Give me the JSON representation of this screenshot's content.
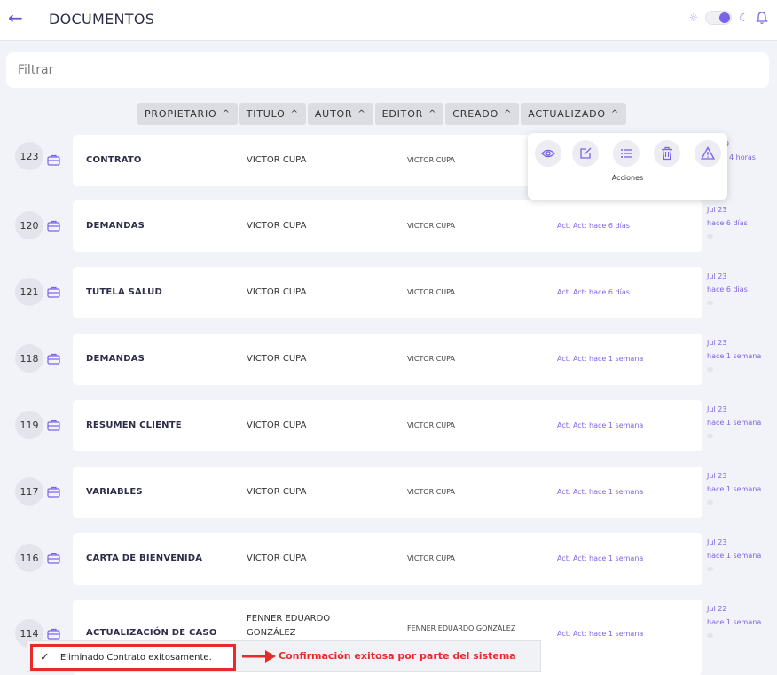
{
  "header": {
    "back_icon": "arrow-left-icon",
    "title": "DOCUMENTOS",
    "theme_icons": [
      "sun-icon",
      "toggle",
      "moon-icon",
      "bell-icon"
    ]
  },
  "filter": {
    "placeholder": "Filtrar",
    "value": ""
  },
  "sort_buttons": [
    "PROPIETARIO",
    "TITULO",
    "AUTOR",
    "EDITOR",
    "CREADO",
    "ACTUALIZADO"
  ],
  "rows": [
    {
      "id": "123",
      "title": "CONTRATO",
      "owner": "VICTOR CUPA",
      "author": "VICTOR CUPA",
      "act": "",
      "date": "9",
      "ago": "4 horas"
    },
    {
      "id": "120",
      "title": "DEMANDAS",
      "owner": "VICTOR CUPA",
      "author": "VICTOR CUPA",
      "act": "Act. Act: hace 6 días",
      "date": "Jul 23",
      "ago": "hace 6 días"
    },
    {
      "id": "121",
      "title": "TUTELA SALUD",
      "owner": "VICTOR CUPA",
      "author": "VICTOR CUPA",
      "act": "Act. Act: hace 6 días",
      "date": "Jul 23",
      "ago": "hace 6 días"
    },
    {
      "id": "118",
      "title": "DEMANDAS",
      "owner": "VICTOR CUPA",
      "author": "VICTOR CUPA",
      "act": "Act. Act: hace 1 semana",
      "date": "Jul 23",
      "ago": "hace 1 semana"
    },
    {
      "id": "119",
      "title": "RESUMEN CLIENTE",
      "owner": "VICTOR CUPA",
      "author": "VICTOR CUPA",
      "act": "Act. Act: hace 1 semana",
      "date": "Jul 23",
      "ago": "hace 1 semana"
    },
    {
      "id": "117",
      "title": "VARIABLES",
      "owner": "VICTOR CUPA",
      "author": "VICTOR CUPA",
      "act": "Act. Act: hace 1 semana",
      "date": "Jul 23",
      "ago": "hace 1 semana"
    },
    {
      "id": "116",
      "title": "CARTA DE BIENVENIDA",
      "owner": "VICTOR CUPA",
      "author": "VICTOR CUPA",
      "act": "Act. Act: hace 1 semana",
      "date": "Jul 23",
      "ago": "hace 1 semana"
    },
    {
      "id": "114",
      "title": "ACTUALIZACIÓN DE CASO",
      "owner": "FENNER EDUARDO GONZÁLEZ",
      "author": "FENNER EDUARDO GONZÁLEZ",
      "act": "Act. Act: hace 1 semana",
      "date": "Jul 22",
      "ago": "hace 1 semana"
    }
  ],
  "actions_popup": {
    "label": "Acciones",
    "buttons": [
      "eye-icon",
      "edit-icon",
      "list-icon",
      "trash-icon",
      "warning-icon"
    ]
  },
  "toast": {
    "message": "Eliminado Contrato exitosamente.",
    "annotation": "Confirmación exitosa por parte del sistema"
  },
  "colors": {
    "accent": "#7b62ea",
    "annotation": "#e52b2b"
  }
}
